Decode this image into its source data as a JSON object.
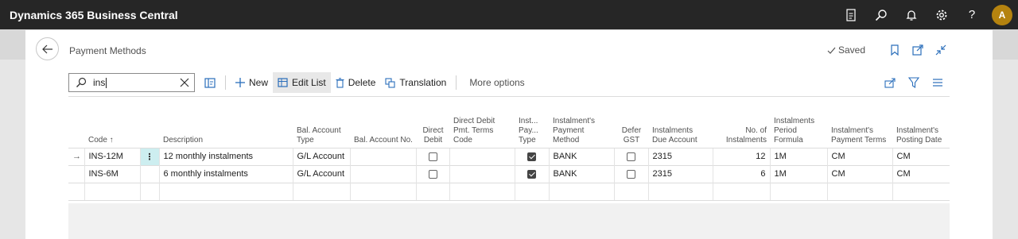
{
  "app_title": "Dynamics 365 Business Central",
  "topbar": {
    "avatar_initial": "A"
  },
  "page": {
    "title": "Payment Methods",
    "saved_label": "Saved"
  },
  "search": {
    "value": "ins"
  },
  "actions": {
    "new": "New",
    "edit_list": "Edit List",
    "delete": "Delete",
    "translation": "Translation",
    "more_options": "More options"
  },
  "columns": [
    "Code",
    "Description",
    "Bal. Account Type",
    "Bal. Account No.",
    "Direct Debit",
    "Direct Debit Pmt. Terms Code",
    "Inst... Pay... Type",
    "Instalment's Payment Method",
    "Defer GST",
    "Instalments Due Account",
    "No. of Instalments",
    "Instalments Period Formula",
    "Instalment's Payment Terms",
    "Instalment's Posting Date"
  ],
  "rows": [
    {
      "code": "INS-12M",
      "description": "12 monthly instalments",
      "bal_account_type": "G/L Account",
      "bal_account_no": "",
      "direct_debit": false,
      "dd_terms": "",
      "inst_pay_type": true,
      "payment_method": "BANK",
      "defer_gst": false,
      "due_account": "2315",
      "no_instalments": "12",
      "period_formula": "1M",
      "payment_terms": "CM",
      "posting_date": "CM"
    },
    {
      "code": "INS-6M",
      "description": "6 monthly instalments",
      "bal_account_type": "G/L Account",
      "bal_account_no": "",
      "direct_debit": false,
      "dd_terms": "",
      "inst_pay_type": true,
      "payment_method": "BANK",
      "defer_gst": false,
      "due_account": "2315",
      "no_instalments": "6",
      "period_formula": "1M",
      "payment_terms": "CM",
      "posting_date": "CM"
    }
  ],
  "colors": {
    "topbar": "#262626",
    "avatar": "#b5830f",
    "selected_cell": "#cdeef0"
  }
}
